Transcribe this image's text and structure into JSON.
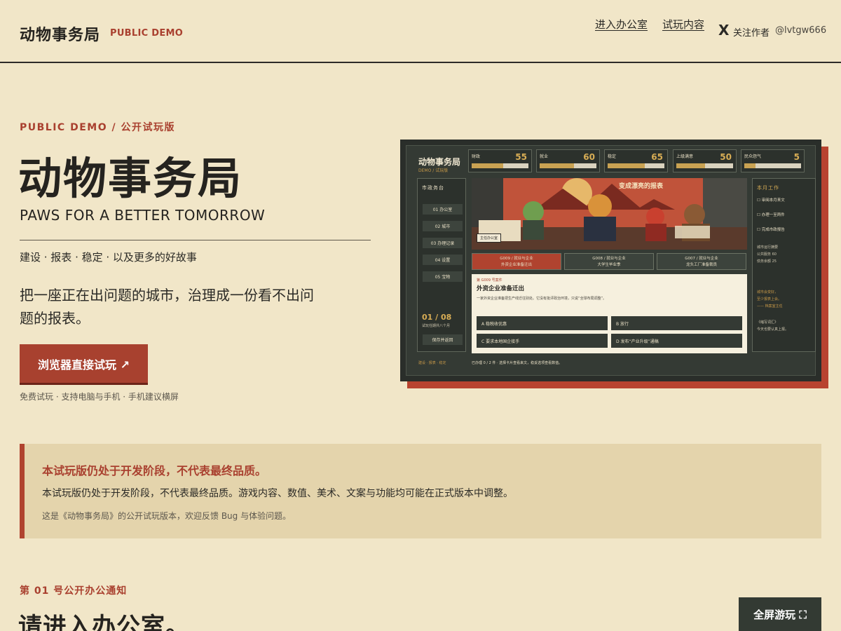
{
  "header": {
    "brand": "动物事务局",
    "brand_tag": "PUBLIC DEMO",
    "nav": [
      "进入办公室",
      "试玩内容"
    ],
    "x_icon": "X",
    "follow_label": "关注作者",
    "handle": "@lvtgw666"
  },
  "hero": {
    "eyebrow": "PUBLIC DEMO / 公开试玩版",
    "title": "动物事务局",
    "subtitle": "PAWS FOR A BETTER TOMORROW",
    "tagline": "建设 · 报表 · 稳定 · 以及更多的好故事",
    "lead": "把一座正在出问题的城市，治理成一份看不出问题的报表。",
    "cta": "浏览器直接试玩 ↗",
    "cta_note": "免费试玩 · 支持电脑与手机 · 手机建议横屏"
  },
  "preview": {
    "logo": "动物事务局",
    "logo_sub": "DEMO / 试玩版",
    "stats": [
      {
        "name": "财政",
        "value": "55",
        "level": 0.55
      },
      {
        "name": "就业",
        "value": "60",
        "level": 0.6
      },
      {
        "name": "稳定",
        "value": "65",
        "level": 0.65
      },
      {
        "name": "上级满意",
        "value": "50",
        "level": 0.5
      },
      {
        "name": "民众怨气",
        "value": "5",
        "level": 0.2
      }
    ],
    "side_title": "市政务台",
    "menu": [
      "01 办公室",
      "02 城市",
      "03 办理记录",
      "04 设置",
      "05 宝物"
    ],
    "date": "01 / 08",
    "date_sub": "试玩任期共八个月",
    "save": "保存并返回",
    "art_headline": "变成漂亮的报表",
    "art_label": "主任办公室",
    "tabs": [
      {
        "line1": "G009 / 就业与企业",
        "line2": "外资企业准备迁出"
      },
      {
        "line1": "G008 / 就业与企业",
        "line2": "大学生毕业季"
      },
      {
        "line1": "G007 / 就业与企业",
        "line2": "龙头工厂准备裁员"
      }
    ],
    "doc_kicker": "第 G009 号案件",
    "doc_title": "外资企业准备迁出",
    "doc_body": "一家外资企业准备把生产线迁往别处。它没有批评政治环境，只说“全球布局调整”。",
    "options": [
      "A 稳税收优惠",
      "B 放行",
      "C 要求本地国企接手",
      "D 发布“产业升级”通稿"
    ],
    "right_title": "本月工作",
    "tasks": [
      "审阅本月来文",
      "办理一至两件",
      "完成市政报告"
    ],
    "right_stats": [
      "城市运行摘要",
      "公共服务 60",
      "债务余额 25"
    ],
    "right_quote": [
      "城市会变好，",
      "至少报表上会。",
      "—— 档案室主任"
    ],
    "right_note": [
      "《缩写词汇》",
      "今天也要认真上报。"
    ],
    "foot_left": "建设 · 报表 · 稳定",
    "foot_mid": "已办理 0 / 2 件  ·  选择卡片查看来文，稳妥选项查看数值。"
  },
  "notice": {
    "title": "本试玩版仍处于开发阶段，不代表最终品质。",
    "body": "本试玩版仍处于开发阶段，不代表最终品质。游戏内容、数值、美术、文案与功能均可能在正式版本中调整。",
    "note": "这是《动物事务局》的公开试玩版本，欢迎反馈 Bug 与体验问题。"
  },
  "section": {
    "eyebrow": "第 01 号公开办公通知",
    "title": "请进入办公室。"
  },
  "fullscreen_button": "全屏游玩 ⛶"
}
